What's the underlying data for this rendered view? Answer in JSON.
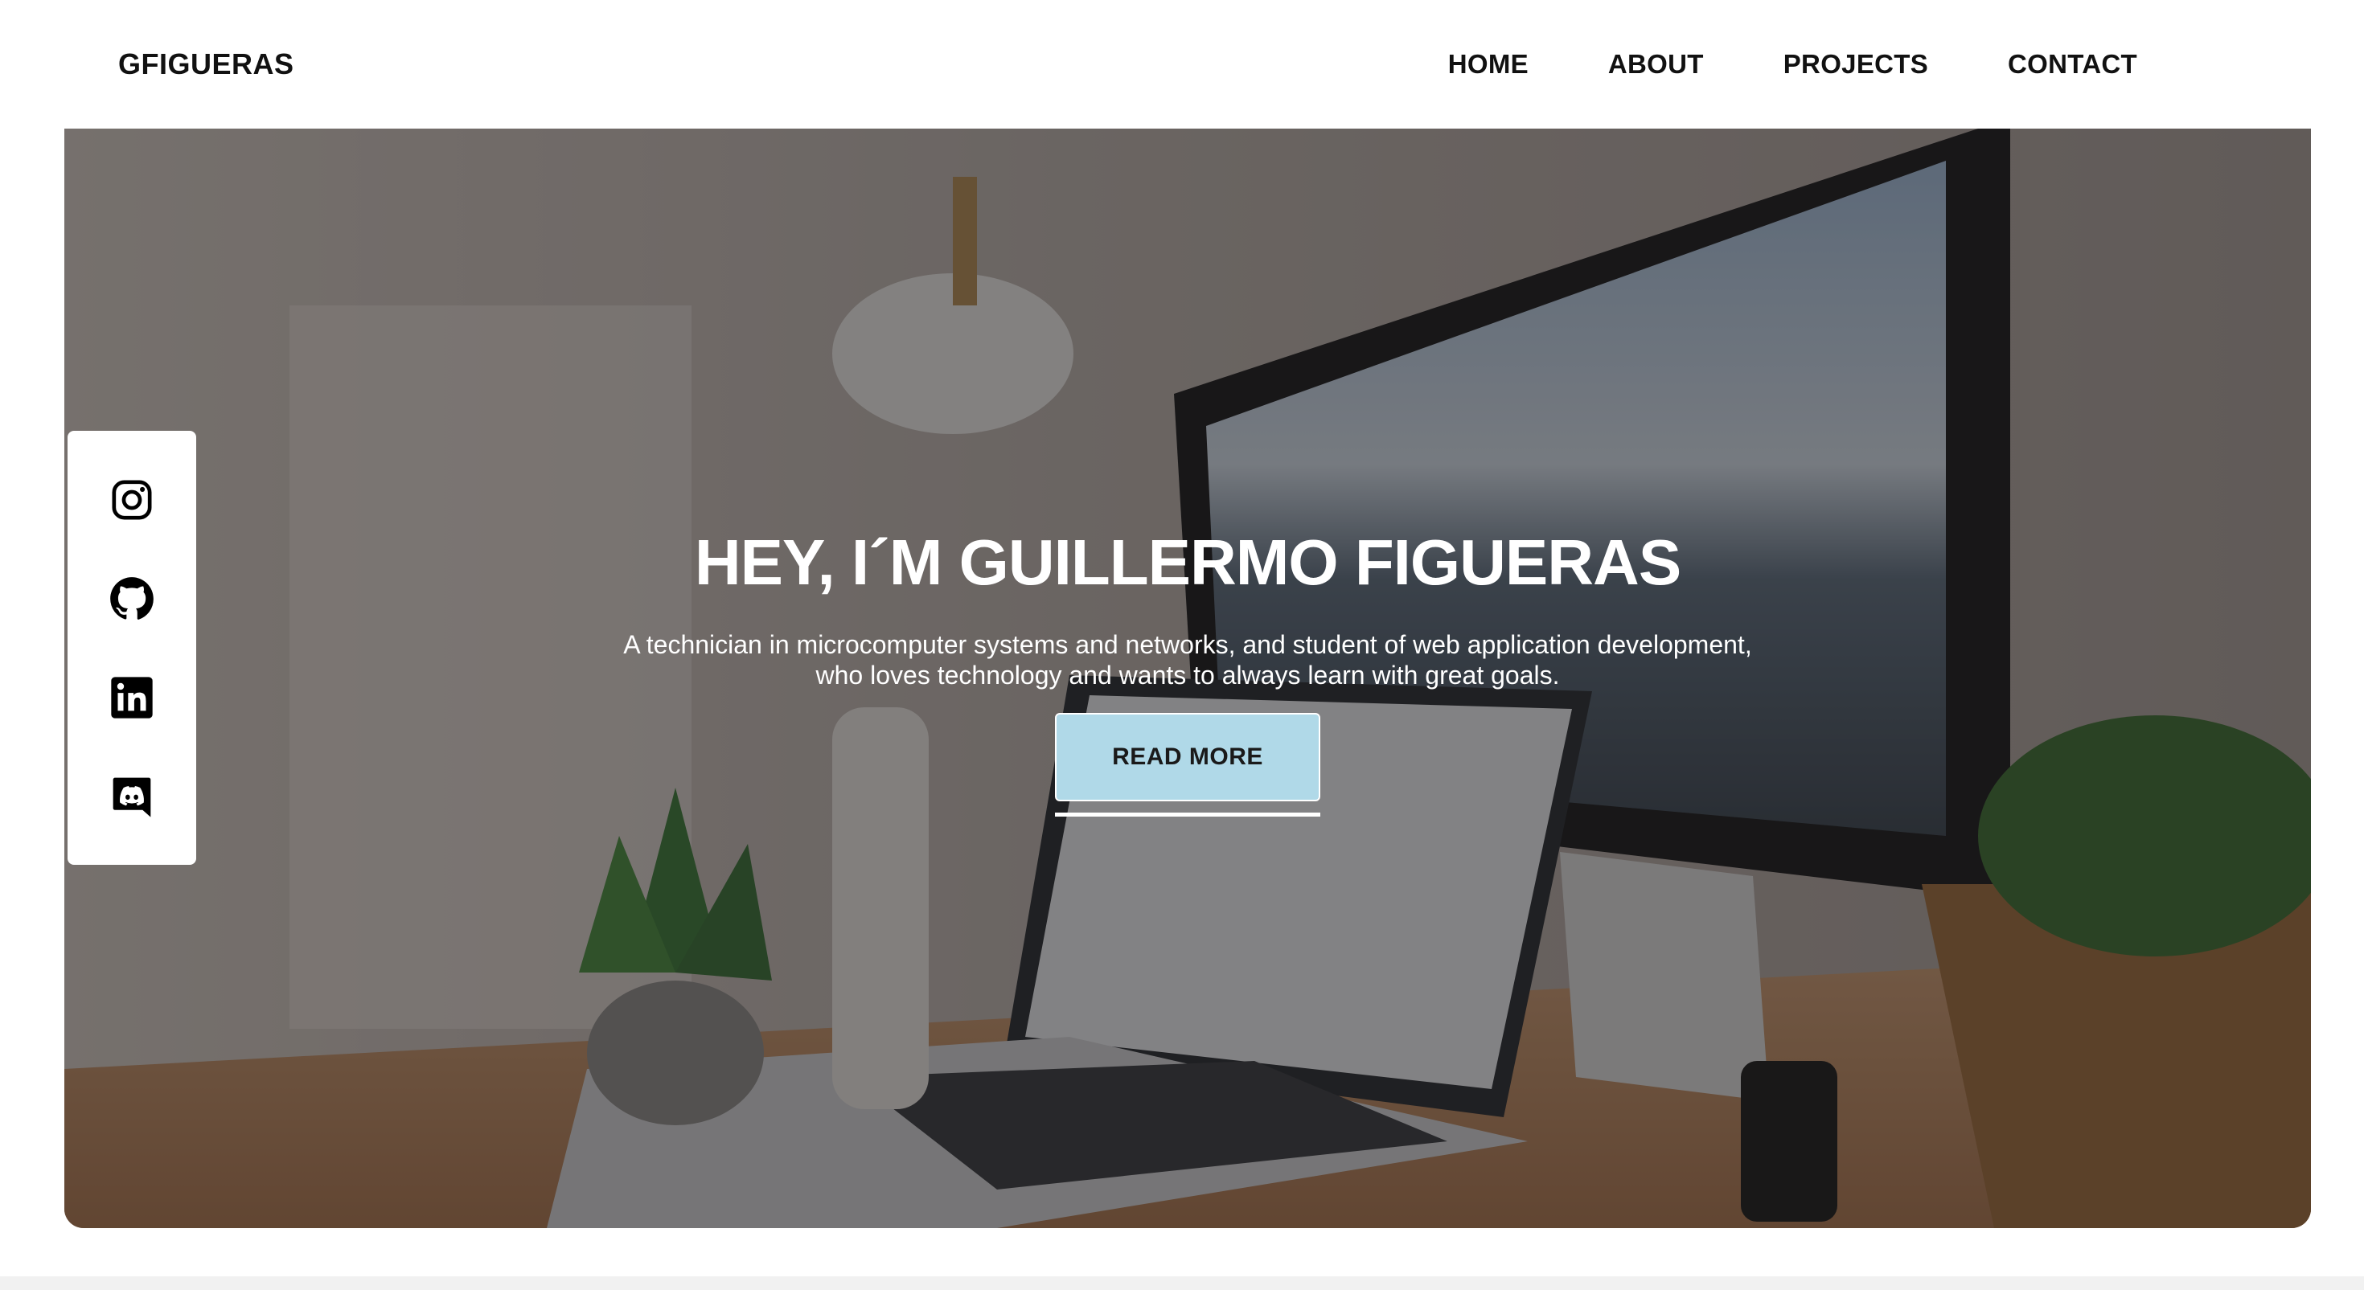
{
  "brand": "GFIGUERAS",
  "nav": {
    "items": [
      {
        "label": "HOME"
      },
      {
        "label": "ABOUT"
      },
      {
        "label": "PROJECTS"
      },
      {
        "label": "CONTACT"
      }
    ]
  },
  "hero": {
    "title": "HEY, I´M GUILLERMO FIGUERAS",
    "subtitle_line1": "A technician in microcomputer systems and networks, and student of web application development,",
    "subtitle_line2": "who loves technology and wants to always learn with great goals.",
    "cta_label": "READ MORE",
    "cta_color": "#b0d9e8"
  },
  "social": {
    "items": [
      {
        "icon": "instagram-icon"
      },
      {
        "icon": "github-icon"
      },
      {
        "icon": "linkedin-icon"
      },
      {
        "icon": "discord-icon"
      }
    ]
  }
}
